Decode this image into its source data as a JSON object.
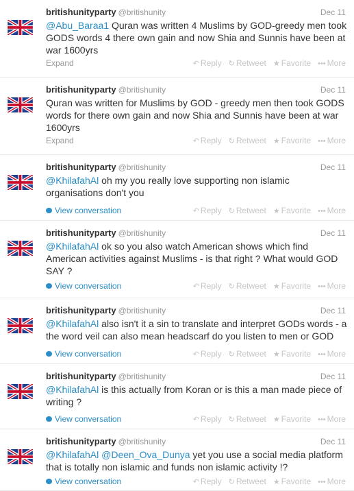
{
  "tweets": [
    {
      "name": "britishunityparty",
      "handle": "@britishunity",
      "date": "Dec 11",
      "mentions": "@Abu_Baraa1",
      "text": " Quran was written 4 Muslims by GOD-greedy men took GODS words 4 there own gain and now Shia and Sunnis have been at war 1600yrs",
      "footer_label": "Expand",
      "actions": {
        "reply": "Reply",
        "retweet": "Retweet",
        "favorite": "Favorite",
        "more": "More"
      }
    },
    {
      "name": "britishunityparty",
      "handle": "@britishunity",
      "date": "Dec 11",
      "mentions": "",
      "text": "Quran was written for Muslims by GOD - greedy men then took GODS words for there own gain and now Shia and Sunnis have been at war 1600yrs",
      "footer_label": "Expand",
      "actions": {
        "reply": "Reply",
        "retweet": "Retweet",
        "favorite": "Favorite",
        "more": "More"
      }
    },
    {
      "name": "britishunityparty",
      "handle": "@britishunity",
      "date": "Dec 11",
      "mentions": "@KhilafahAl",
      "text": " oh my you really love supporting non islamic organisations don't you",
      "footer_label": "View conversation",
      "actions": {
        "reply": "Reply",
        "retweet": "Retweet",
        "favorite": "Favorite",
        "more": "More"
      }
    },
    {
      "name": "britishunityparty",
      "handle": "@britishunity",
      "date": "Dec 11",
      "mentions": "@KhilafahAl",
      "text": " ok so you also watch American shows which find American activities against Muslims - is that right ? What would GOD SAY ?",
      "footer_label": "View conversation",
      "actions": {
        "reply": "Reply",
        "retweet": "Retweet",
        "favorite": "Favorite",
        "more": "More"
      }
    },
    {
      "name": "britishunityparty",
      "handle": "@britishunity",
      "date": "Dec 11",
      "mentions": "@KhilafahAl",
      "text": " also isn't it a sin to translate and interpret GODs words - a the word veil can also mean headscarf do you listen to men or GOD",
      "footer_label": "View conversation",
      "actions": {
        "reply": "Reply",
        "retweet": "Retweet",
        "favorite": "Favorite",
        "more": "More"
      }
    },
    {
      "name": "britishunityparty",
      "handle": "@britishunity",
      "date": "Dec 11",
      "mentions": "@KhilafahAl",
      "text": " is this actually from Koran or is this a man made piece of writing ?",
      "footer_label": "View conversation",
      "actions": {
        "reply": "Reply",
        "retweet": "Retweet",
        "favorite": "Favorite",
        "more": "More"
      }
    },
    {
      "name": "britishunityparty",
      "handle": "@britishunity",
      "date": "Dec 11",
      "mentions": "@KhilafahAl @Deen_Ova_Dunya",
      "text": " yet you use a social media platform that is totally non islamic and funds non islamic activity !?",
      "footer_label": "View conversation",
      "actions": {
        "reply": "Reply",
        "retweet": "Retweet",
        "favorite": "Favorite",
        "more": "More"
      }
    }
  ],
  "icons": {
    "avatar": "union-jack-flag-icon",
    "reply": "reply-arrow-icon",
    "retweet": "retweet-icon",
    "favorite": "star-icon",
    "more": "more-dots-icon",
    "conversation": "speech-bubble-icon"
  },
  "colors": {
    "link": "#2a8fc9",
    "muted": "#999999",
    "action": "#c6c6c6",
    "divider": "#e8e8e8"
  }
}
